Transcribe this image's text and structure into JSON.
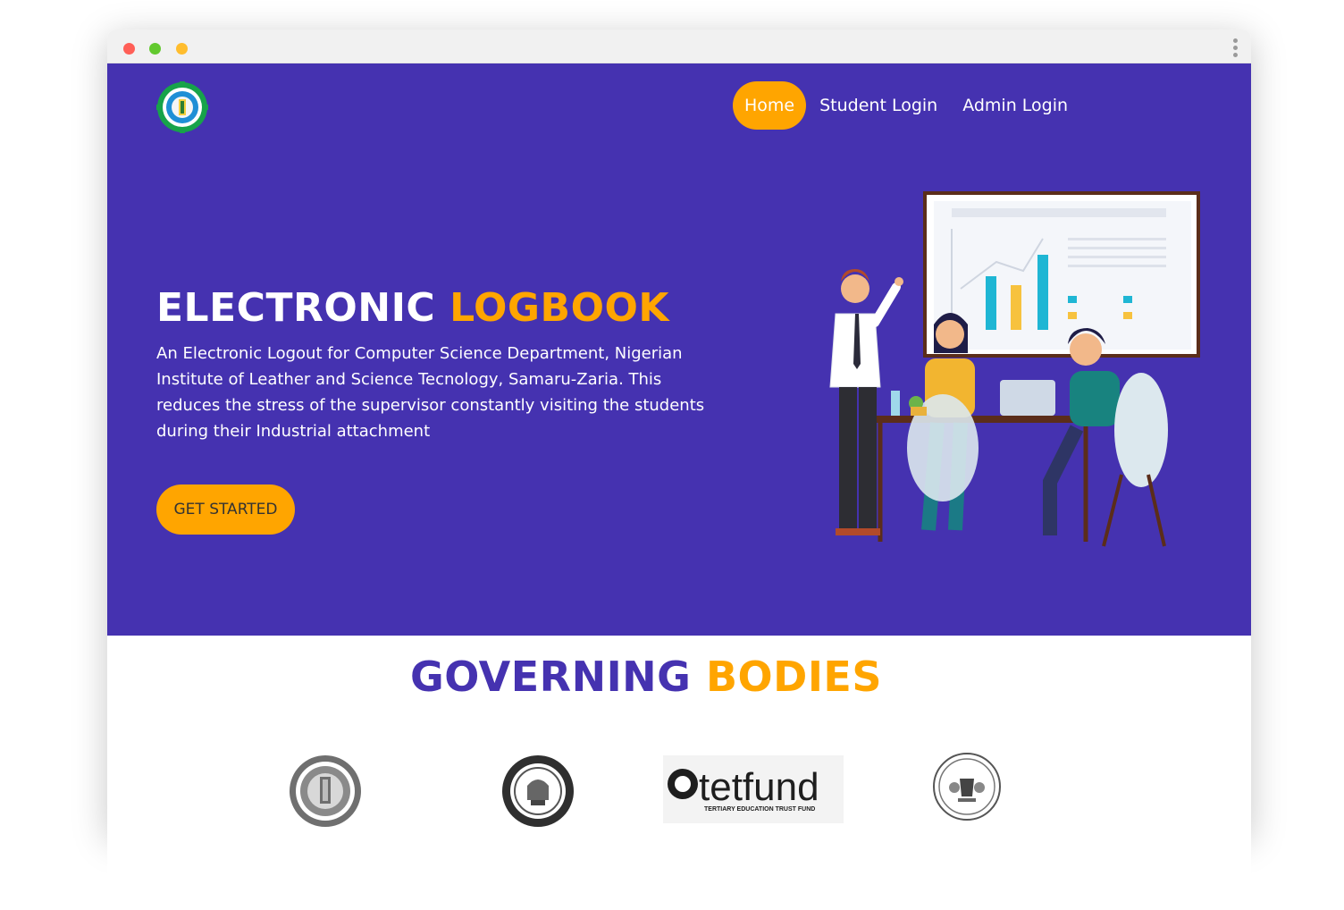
{
  "browser": {
    "controls": [
      "close",
      "minimize",
      "maximize"
    ],
    "menu_icon": "kebab-menu-icon"
  },
  "header": {
    "logo_icon": "institute-logo-icon",
    "nav": [
      {
        "label": "Home",
        "active": true
      },
      {
        "label": "Student Login",
        "active": false
      },
      {
        "label": "Admin Login",
        "active": false
      }
    ]
  },
  "hero": {
    "title_main": "ELECTRONIC",
    "title_accent": "LOGBOOK",
    "description": "An Electronic Logout for Computer Science Department, Nigerian Institute of Leather and Science Tecnology, Samaru-Zaria. This reduces the stress of the supervisor constantly visiting the students during their Industrial attachment",
    "cta_label": "GET STARTED",
    "illustration": "team-meeting-illustration"
  },
  "governing": {
    "title_main": "GOVERNING",
    "title_accent": "BODIES",
    "logos": [
      {
        "icon": "nilest-logo"
      },
      {
        "icon": "itf-logo"
      },
      {
        "icon": "tetfund-logo",
        "wordmark": "tetfund",
        "tagline": "TERTIARY EDUCATION TRUST FUND"
      },
      {
        "icon": "nigeria-coat-of-arms-logo"
      }
    ]
  },
  "colors": {
    "primary": "#4532b0",
    "accent": "#ffa500",
    "white": "#ffffff"
  }
}
